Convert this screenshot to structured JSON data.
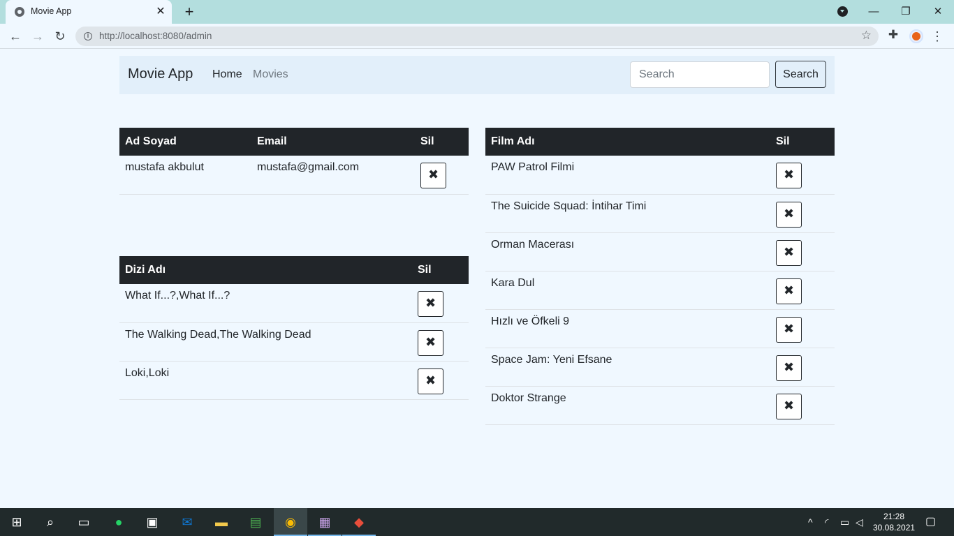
{
  "browser": {
    "tab_title": "Movie App",
    "url": "http://localhost:8080/admin",
    "tab_close": "✕",
    "new_tab": "+",
    "controls": {
      "minimize": "—",
      "restore": "❐",
      "close": "✕"
    }
  },
  "navbar": {
    "brand": "Movie App",
    "home": "Home",
    "movies": "Movies",
    "search_placeholder": "Search",
    "search_button": "Search"
  },
  "users_table": {
    "headers": [
      "Ad Soyad",
      "Email",
      "Sil"
    ],
    "rows": [
      {
        "name": "mustafa akbulut",
        "email": "mustafa@gmail.com"
      }
    ]
  },
  "series_table": {
    "headers": [
      "Dizi Adı",
      "Sil"
    ],
    "rows": [
      "What If...?,What If...?",
      "The Walking Dead,The Walking Dead",
      "Loki,Loki"
    ]
  },
  "films_table": {
    "headers": [
      "Film Adı",
      "Sil"
    ],
    "rows": [
      "PAW Patrol Filmi",
      "The Suicide Squad: İntihar Timi",
      "Orman Macerası",
      "Kara Dul",
      "Hızlı ve Öfkeli 9",
      "Space Jam: Yeni Efsane",
      "Doktor Strange"
    ]
  },
  "delete_glyph": "✖",
  "taskbar": {
    "time": "21:28",
    "date": "30.08.2021"
  },
  "colors": {
    "page_bg": "#f0f8ff",
    "navbar_bg": "#e2effa",
    "table_header_bg": "#212529",
    "tabstrip_bg": "#b3dede",
    "taskbar_bg": "#212a2b"
  }
}
